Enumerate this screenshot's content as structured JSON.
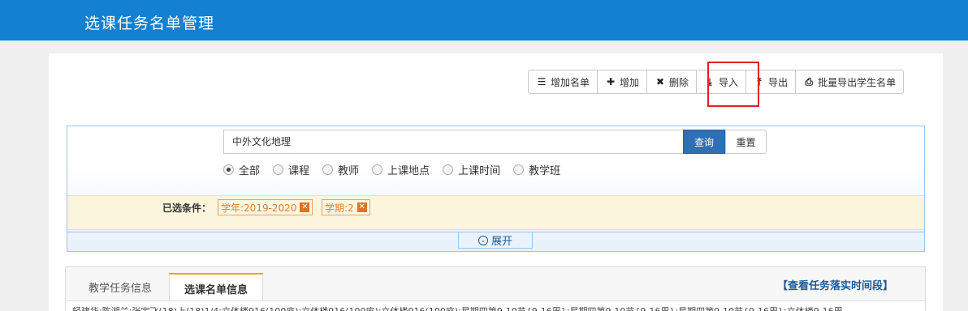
{
  "header": {
    "title": "选课任务名单管理"
  },
  "toolbar": {
    "buttons": [
      {
        "label": "增加名单",
        "icon": "list-icon"
      },
      {
        "label": "增加",
        "icon": "plus-icon"
      },
      {
        "label": "删除",
        "icon": "remove-icon"
      },
      {
        "label": "导入",
        "icon": "import-icon"
      },
      {
        "label": "导出",
        "icon": "export-icon"
      },
      {
        "label": "批量导出学生名单",
        "icon": "print-icon"
      }
    ]
  },
  "search": {
    "value": "中外文化地理",
    "query_label": "查询",
    "reset_label": "重置",
    "options": [
      "全部",
      "课程",
      "教师",
      "上课地点",
      "上课时间",
      "教学班"
    ],
    "selected": "全部"
  },
  "conditions": {
    "label": "已选条件：",
    "tags": [
      "学年:2019-2020",
      "学期:2"
    ]
  },
  "expand_label": "展开",
  "tabs": {
    "items": [
      "教学任务信息",
      "选课名单信息"
    ],
    "active": "选课名单信息",
    "link": "【查看任务落实时间段】"
  },
  "tab_content": {
    "row_text": "轻建华;陈湘兰;张宇飞(18)上(18)1/4;立体楼916(100座);立体楼916(100座);立体楼916(100座);星期四第9-10节{9-16周};星期四第9-10节{9-16周};星期四第9-10节{9-16周};立体楼9-16周"
  }
}
